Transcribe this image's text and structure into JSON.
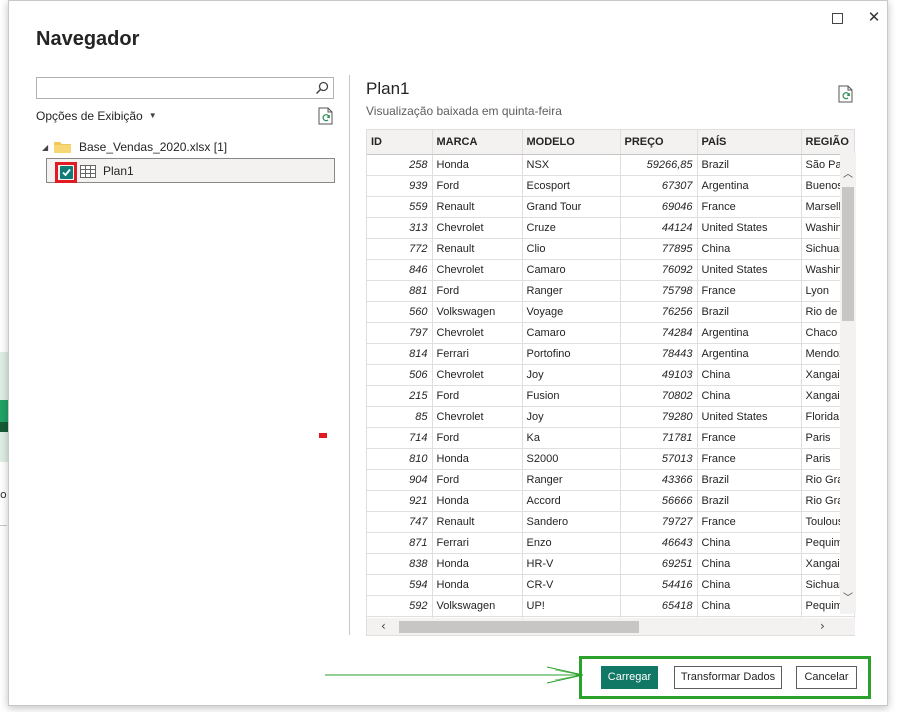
{
  "dialog": {
    "title": "Navegador",
    "maximize_icon": "maximize-icon",
    "close_symbol": "✕"
  },
  "left_pane": {
    "search": {
      "value": "",
      "placeholder": "",
      "icon": "search-icon"
    },
    "view_options_label": "Opções de Exibição",
    "tree": {
      "folder_label": "Base_Vendas_2020.xlsx [1]",
      "items": [
        {
          "label": "Plan1",
          "checked": true
        }
      ]
    }
  },
  "preview": {
    "title": "Plan1",
    "subtitle": "Visualização baixada em quinta-feira",
    "columns": [
      "ID",
      "MARCA",
      "MODELO",
      "PREÇO",
      "PAÍS",
      "REGIÃO"
    ],
    "rows": [
      [
        "258",
        "Honda",
        "NSX",
        "59266,85",
        "Brazil",
        "São Pau"
      ],
      [
        "939",
        "Ford",
        "Ecosport",
        "67307",
        "Argentina",
        "Buenos"
      ],
      [
        "559",
        "Renault",
        "Grand Tour",
        "69046",
        "France",
        "Marsell"
      ],
      [
        "313",
        "Chevrolet",
        "Cruze",
        "44124",
        "United States",
        "Washin"
      ],
      [
        "772",
        "Renault",
        "Clio",
        "77895",
        "China",
        "Sichuar"
      ],
      [
        "846",
        "Chevrolet",
        "Camaro",
        "76092",
        "United States",
        "Washin"
      ],
      [
        "881",
        "Ford",
        "Ranger",
        "75798",
        "France",
        "Lyon"
      ],
      [
        "560",
        "Volkswagen",
        "Voyage",
        "76256",
        "Brazil",
        "Rio de J"
      ],
      [
        "797",
        "Chevrolet",
        "Camaro",
        "74284",
        "Argentina",
        "Chaco"
      ],
      [
        "814",
        "Ferrari",
        "Portofino",
        "78443",
        "Argentina",
        "Mendoz"
      ],
      [
        "506",
        "Chevrolet",
        "Joy",
        "49103",
        "China",
        "Xangai"
      ],
      [
        "215",
        "Ford",
        "Fusion",
        "70802",
        "China",
        "Xangai"
      ],
      [
        "85",
        "Chevrolet",
        "Joy",
        "79280",
        "United States",
        "Florida"
      ],
      [
        "714",
        "Ford",
        "Ka",
        "71781",
        "France",
        "Paris"
      ],
      [
        "810",
        "Honda",
        "S2000",
        "57013",
        "France",
        "Paris"
      ],
      [
        "904",
        "Ford",
        "Ranger",
        "43366",
        "Brazil",
        "Rio Gra"
      ],
      [
        "921",
        "Honda",
        "Accord",
        "56666",
        "Brazil",
        "Rio Gra"
      ],
      [
        "747",
        "Renault",
        "Sandero",
        "79727",
        "France",
        "Toulous"
      ],
      [
        "871",
        "Ferrari",
        "Enzo",
        "46643",
        "China",
        "Pequim"
      ],
      [
        "838",
        "Honda",
        "HR-V",
        "69251",
        "China",
        "Xangai"
      ],
      [
        "594",
        "Honda",
        "CR-V",
        "54416",
        "China",
        "Sichuar"
      ],
      [
        "592",
        "Volkswagen",
        "UP!",
        "65418",
        "China",
        "Pequim"
      ],
      [
        "",
        "",
        "",
        "",
        "",
        ""
      ]
    ]
  },
  "footer": {
    "load_label": "Carregar",
    "transform_label": "Transformar Dados",
    "cancel_label": "Cancelar"
  },
  "colors": {
    "primary_button": "#117865",
    "checkbox": "#107c76",
    "highlight_red": "#e01b24",
    "highlight_green": "#2aa12b"
  }
}
